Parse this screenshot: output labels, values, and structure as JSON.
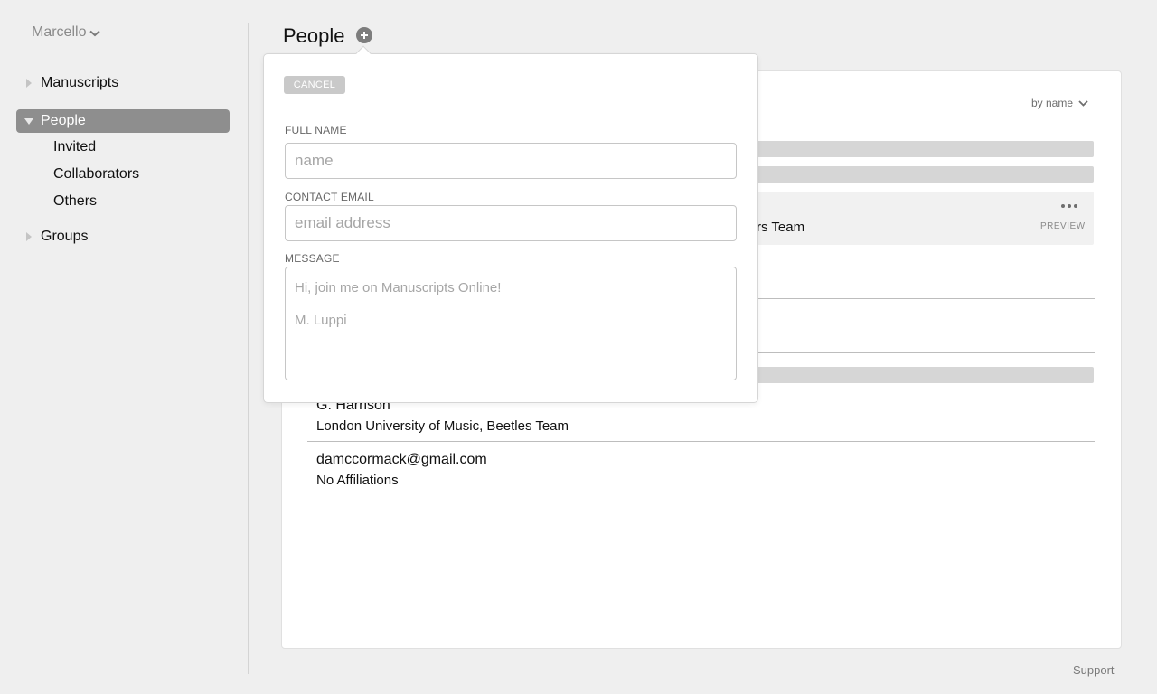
{
  "sidebar": {
    "user_name": "Marcello",
    "items": [
      {
        "label": "Manuscripts"
      },
      {
        "label": "People"
      },
      {
        "label": "Groups"
      }
    ],
    "people_sub": [
      {
        "label": "Invited"
      },
      {
        "label": "Collaborators"
      },
      {
        "label": "Others"
      }
    ]
  },
  "header": {
    "title": "People"
  },
  "list": {
    "sort_label": "by name",
    "highlight_row_partial": "rs Team",
    "preview_label": "PREVIEW",
    "people": [
      {
        "name": "G. Harrison",
        "affiliation": "London University of Music, Beetles Team"
      },
      {
        "name": "damccormack@gmail.com",
        "affiliation": "No Affiliations"
      }
    ]
  },
  "invite_form": {
    "cancel_label": "CANCEL",
    "full_name_label": "FULL NAME",
    "full_name_placeholder": "name",
    "email_label": "CONTACT EMAIL",
    "email_placeholder": "email address",
    "message_label": "MESSAGE",
    "message_line1": "Hi,  join me on Manuscripts Online!",
    "message_line2": "M. Luppi"
  },
  "footer": {
    "support_label": "Support"
  },
  "colors": {
    "background": "#efefef",
    "selected_nav": "#8e8e8e",
    "placeholder_bar": "#d6d6d6"
  }
}
